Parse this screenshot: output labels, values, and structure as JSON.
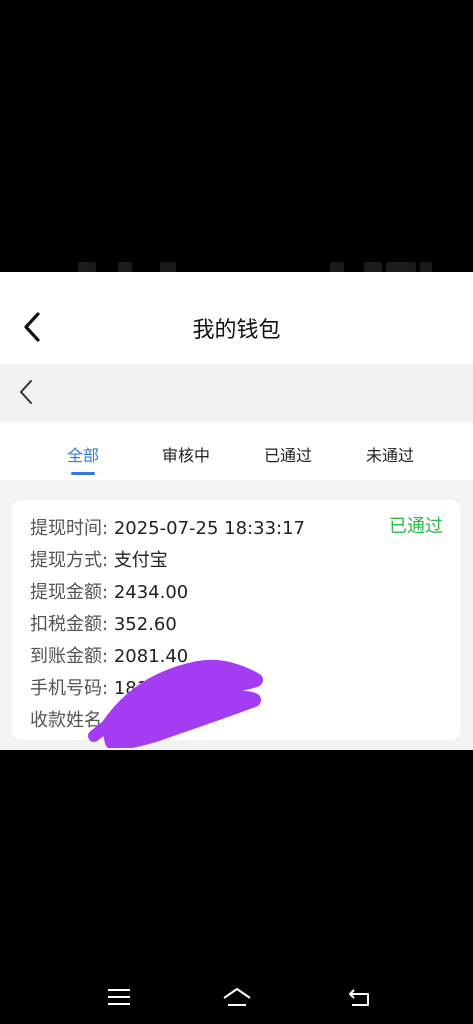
{
  "header": {
    "title": "我的钱包"
  },
  "tabs": [
    {
      "label": "全部",
      "active": true
    },
    {
      "label": "审核中",
      "active": false
    },
    {
      "label": "已通过",
      "active": false
    },
    {
      "label": "未通过",
      "active": false
    }
  ],
  "record": {
    "status": "已通过",
    "rows": [
      {
        "label": "提现时间:",
        "value": "2025-07-25 18:33:17"
      },
      {
        "label": "提现方式:",
        "value": "支付宝"
      },
      {
        "label": "提现金额:",
        "value": "2434.00"
      },
      {
        "label": "扣税金额:",
        "value": "352.60"
      },
      {
        "label": "到账金额:",
        "value": "2081.40"
      },
      {
        "label": "手机号码:",
        "value": "181"
      },
      {
        "label": "收款姓名",
        "value": ""
      }
    ]
  },
  "colors": {
    "accent": "#2f7be0",
    "success": "#2db84b",
    "redaction": "#a33cf2"
  },
  "icons": {
    "back": "back-chevron-icon",
    "menu": "menu-icon",
    "home": "home-icon",
    "return": "return-icon"
  }
}
